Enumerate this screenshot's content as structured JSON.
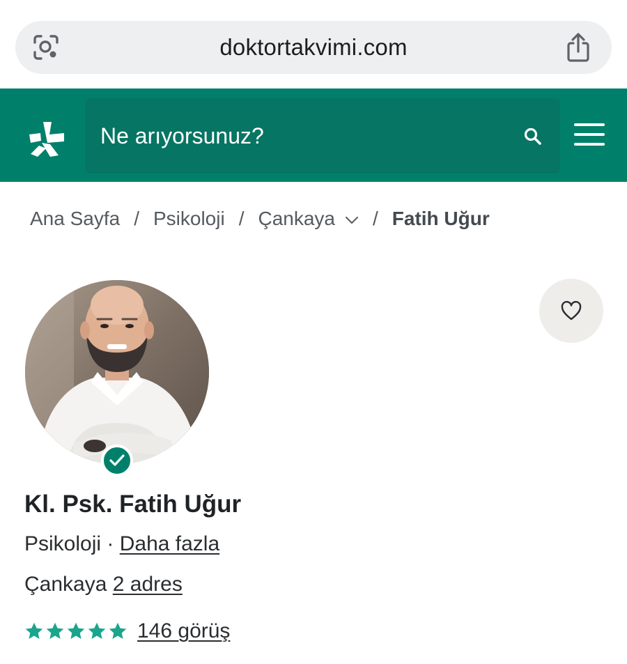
{
  "browser": {
    "url": "doktortakvimi.com",
    "lens_icon": "visual-lookup-icon",
    "share_icon": "share-icon"
  },
  "header": {
    "logo_icon": "doktortakvimi-logo-icon",
    "search_placeholder": "Ne arıyorsunuz?",
    "search_icon": "search-icon",
    "menu_icon": "hamburger-menu-icon",
    "brand_color": "#00806a"
  },
  "breadcrumb": {
    "items": [
      "Ana Sayfa",
      "Psikoloji",
      "Çankaya"
    ],
    "separator": "/",
    "current": "Fatih Uğur"
  },
  "profile": {
    "name": "Kl. Psk. Fatih Uğur",
    "specialty": "Psikoloji",
    "specialty_separator": "·",
    "more_link": "Daha fazla",
    "district": "Çankaya",
    "addresses_link": "2 adres",
    "stars": 5,
    "star_color": "#1aa58c",
    "reviews_link": "146 görüş",
    "verified": true
  }
}
